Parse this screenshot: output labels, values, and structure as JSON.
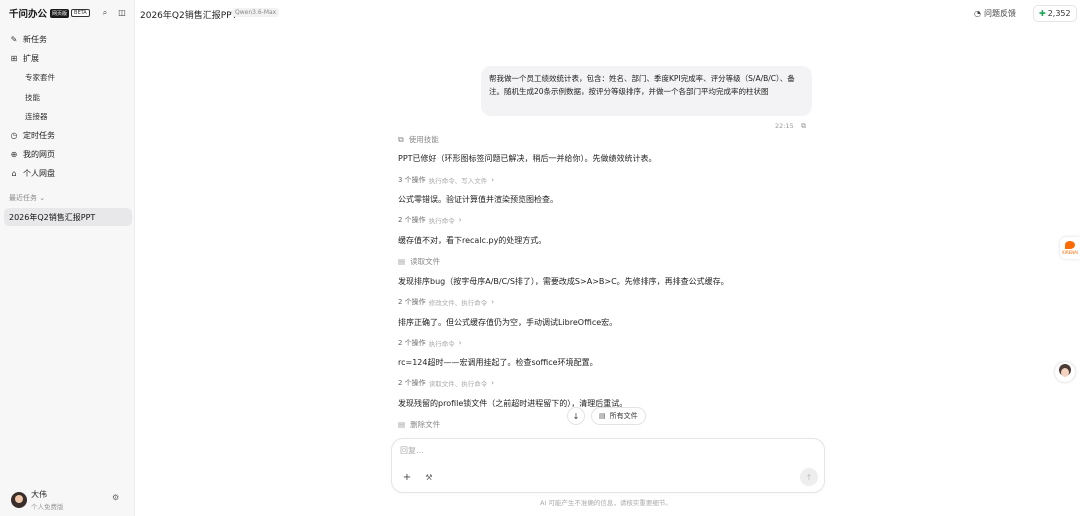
{
  "sidebar": {
    "brand": "千问办公",
    "badge_a": "网页版",
    "badge_b": "BETA",
    "nav": {
      "new_task": "新任务",
      "extensions": "扩展",
      "expert_kit": "专家套件",
      "skills": "技能",
      "connectors": "连接器",
      "scheduled": "定时任务",
      "my_pages": "我的网页",
      "personal_drive": "个人网盘"
    },
    "recent_label": "最近任务",
    "recent_items": [
      "2026年Q2销售汇报PPT"
    ],
    "user": {
      "name": "大伟",
      "plan": "个人免费版"
    }
  },
  "topbar": {
    "title": "2026年Q2销售汇报PPT",
    "model": "Qwen3.6-Max",
    "feedback": "问题反馈",
    "points": "2,352"
  },
  "conversation": {
    "user_message": "帮我做一个员工绩效统计表，包含：姓名、部门、季度KPI完成率、评分等级（S/A/B/C）、备注。随机生成20条示例数据，按评分等级排序，并做一个各部门平均完成率的柱状图",
    "time": "22:15",
    "skill_label": "使用技能",
    "messages": [
      "PPT已修好（环形图标签问题已解决，稍后一并给你）。先做绩效统计表。",
      "公式零错误。验证计算值并渲染预览图检查。",
      "缓存值不对，看下recalc.py的处理方式。",
      "发现排序bug（按字母序A/B/C/S排了），需要改成S>A>B>C。先修排序，再排查公式缓存。",
      "排序正确了。但公式缓存值仍为空，手动调试LibreOffice宏。",
      "rc=124超时——宏调用挂起了。检查soffice环境配置。",
      "发现残留的profile锁文件（之前超时进程留下的），清理后重试。"
    ],
    "ops": [
      {
        "count": "3 个操作",
        "detail": "执行命令、写入文件"
      },
      {
        "count": "2 个操作",
        "detail": "执行命令"
      },
      {
        "count": "2 个操作",
        "detail": "修改文件、执行命令"
      },
      {
        "count": "2 个操作",
        "detail": "执行命令"
      },
      {
        "count": "2 个操作",
        "detail": "读取文件、执行命令"
      }
    ],
    "file_ops": [
      "读取文件",
      "删除文件"
    ]
  },
  "composer": {
    "placeholder": "回复...",
    "all_files": "所有文件",
    "disclaimer": "AI 可能产生不准确的信息，请核实重要细节。"
  },
  "float_ad_text": "XIRENAI"
}
